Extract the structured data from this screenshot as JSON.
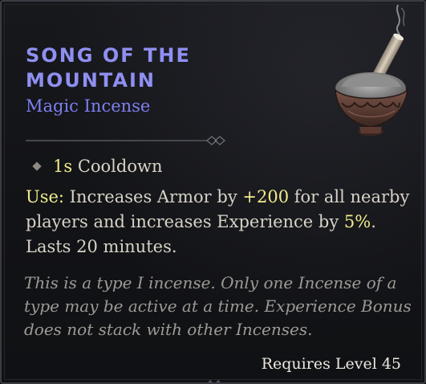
{
  "item": {
    "title_line1": "Song of the",
    "title_line2": "Mountain",
    "type": "Magic Incense",
    "icon": "incense-bowl-icon"
  },
  "cooldown": {
    "value": "1s",
    "label": "Cooldown"
  },
  "use": {
    "label": "Use:",
    "text_1": "Increases Armor by",
    "armor_value": "+200",
    "text_2": "for all nearby players and increases Experience by",
    "xp_value": "5%",
    "text_3": ". Lasts 20 minutes."
  },
  "flavor": "This is a type I incense. Only one Incense of a type may be active at a time. Experience Bonus does not stack with other Incenses.",
  "requires": "Requires Level 45",
  "colors": {
    "title": "#8f8ff2",
    "magic": "#7f7ff0",
    "highlight": "#f2ec8d",
    "body": "#d7d3c7",
    "flavor": "#9c9a96"
  }
}
